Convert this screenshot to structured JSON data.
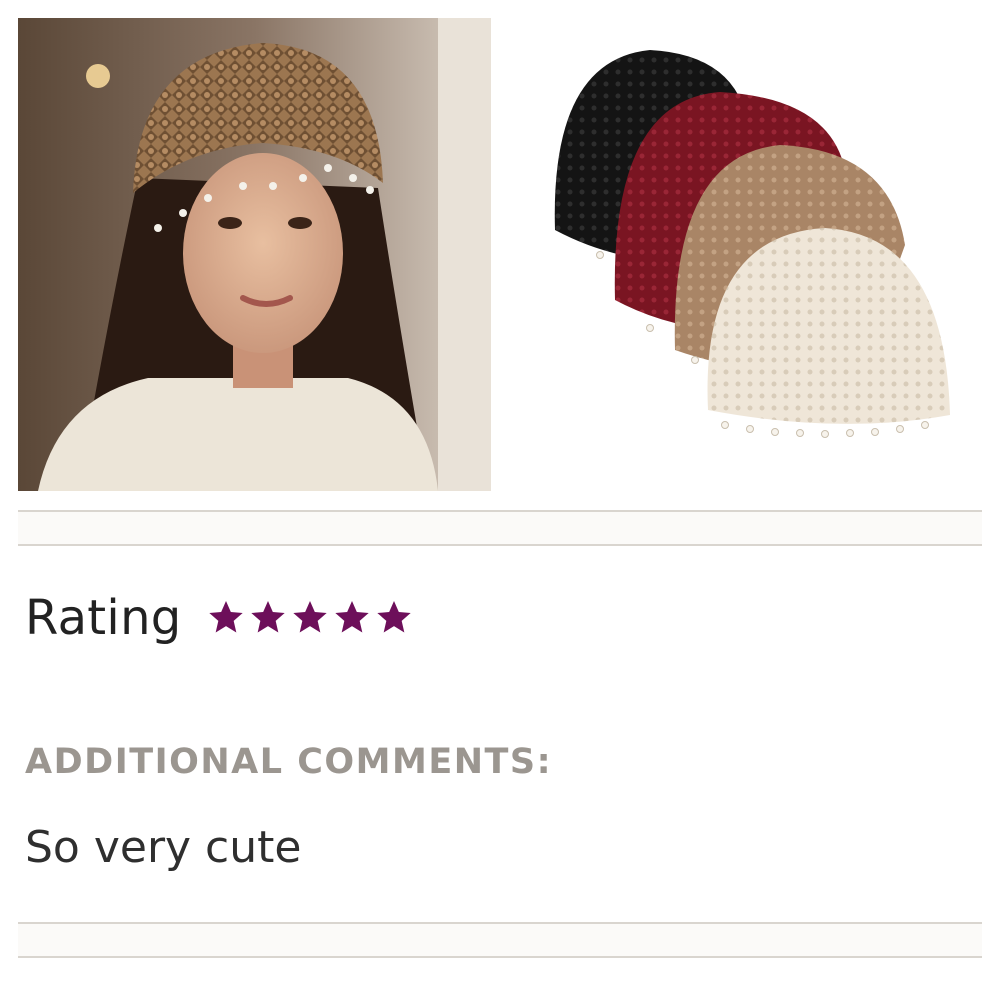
{
  "review": {
    "rating_label": "Rating",
    "rating_value": 5,
    "rating_max": 5,
    "star_color": "#6d0f5a",
    "comments_heading": "ADDITIONAL COMMENTS:",
    "comment": "So very cute"
  },
  "images": {
    "main_photo_icon": "woman-wearing-crochet-beanie-photo",
    "product_photo_icon": "crochet-beanies-four-colors-photo",
    "product_colors": [
      "#141414",
      "#7a1522",
      "#a98566",
      "#efe6d8"
    ]
  }
}
